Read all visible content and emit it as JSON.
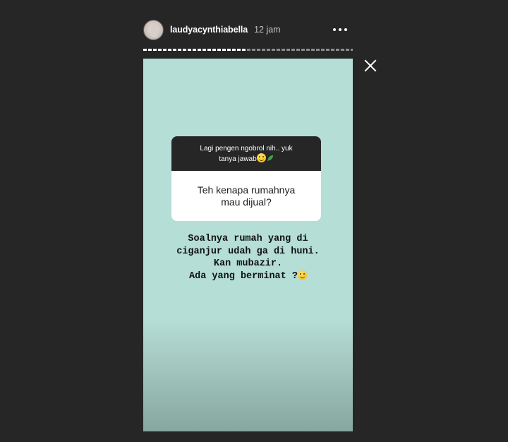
{
  "header": {
    "username": "laudyacynthiabella",
    "time_ago": "12 jam",
    "more_icon": "more-horizontal-icon"
  },
  "progress": {
    "segments": 2,
    "current_fraction": 0.49
  },
  "close_icon": "close-icon",
  "story": {
    "background_color": "#b4ded6",
    "question_box": {
      "prompt_line1": "Lagi pengen ngobrol nih.. yuk",
      "prompt_line2": "tanya jawab",
      "answer_line1": "Teh kenapa rumahnya",
      "answer_line2": "mau dijual?"
    },
    "reply_lines": [
      "Soalnya rumah yang di",
      "ciganjur udah ga di huni.",
      "Kan mubazir.",
      "Ada yang berminat ?"
    ],
    "emoji_names": [
      "grinning-face-icon",
      "leaf-icon",
      "grinning-face-icon"
    ]
  }
}
